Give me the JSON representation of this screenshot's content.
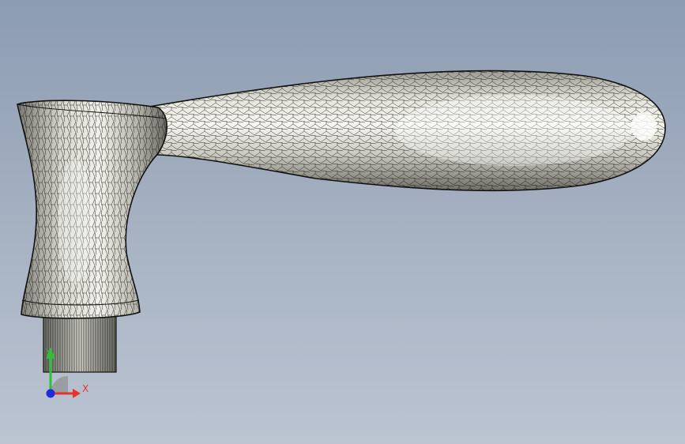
{
  "viewport": {
    "background_top": "#8c9cb2",
    "background_bottom": "#bcc4d2"
  },
  "model": {
    "shape": "crank-handle",
    "display_mode": "wireframe-mesh-over-shaded",
    "surface_color": "#d9d9cf",
    "mesh_color": "#141414"
  },
  "triad": {
    "x_label": "X",
    "y_label": "Y",
    "x_color": "#e8322a",
    "y_color": "#2fbf3a",
    "z_color": "#1e2bd6"
  }
}
